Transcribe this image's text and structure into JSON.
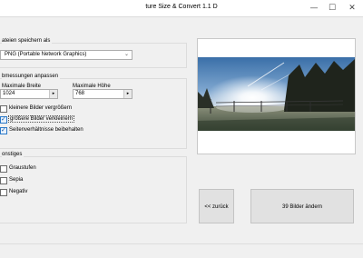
{
  "window": {
    "title": "ture Size & Convert 1.1 D",
    "minimize_glyph": "—",
    "maximize_glyph": "☐",
    "close_glyph": "✕"
  },
  "save_group": {
    "label": "ateien speichern als",
    "format_value": "PNG (Portable Network Graphics)",
    "dropdown_glyph": "⌄"
  },
  "dimensions_group": {
    "label": "bmessungen anpassen",
    "width_label": "Maximale Breite",
    "width_value": "1024",
    "height_label": "Maximale Höhe",
    "height_value": "768",
    "spin_glyph": "▸",
    "options": [
      {
        "label": "kleinere Bilder vergrößern",
        "checked": false
      },
      {
        "label": "größere Bilder verkleinern",
        "checked": true
      },
      {
        "label": "Seitenverhältnisse beibehalten",
        "checked": true
      }
    ],
    "check_glyph": "✓"
  },
  "other_group": {
    "label": "onstiges",
    "options": [
      {
        "label": "Graustufen",
        "checked": false
      },
      {
        "label": "Sepia",
        "checked": false
      },
      {
        "label": "Negativ",
        "checked": false
      }
    ]
  },
  "buttons": {
    "back_label": "<< zurück",
    "convert_label": "39 Bilder ändern"
  },
  "colors": {
    "accent": "#2a79c9",
    "window_bg": "#f0f0f0"
  }
}
